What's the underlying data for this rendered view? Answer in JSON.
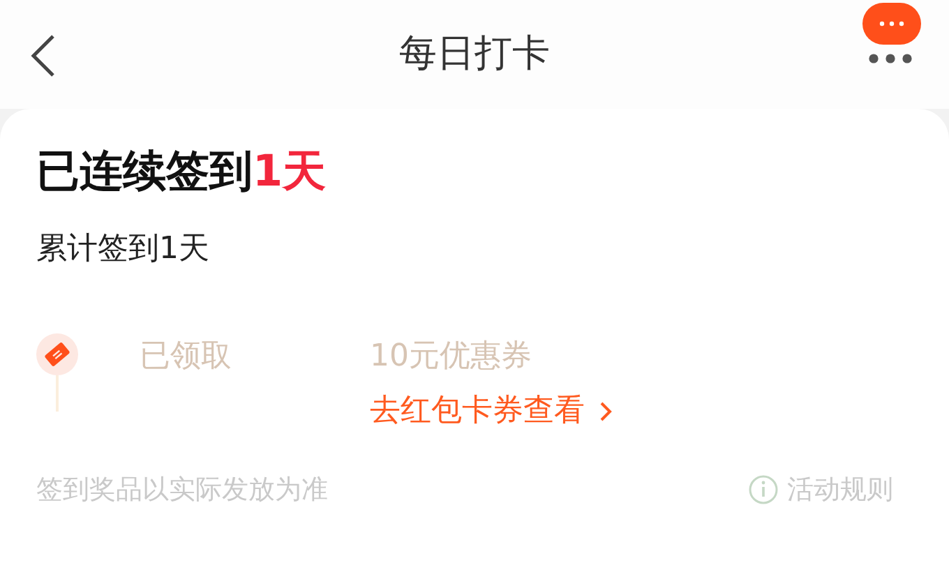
{
  "header": {
    "title": "每日打卡"
  },
  "summary": {
    "streak": "已连续签到**1天**",
    "total": "累计签到1天"
  },
  "rewards": [
    {
      "status": "已领取",
      "prize": "10元优惠券",
      "link": "去红包卡券查看"
    }
  ],
  "footer": {
    "note": "签到奖品以实际发放为准",
    "rules": "活动规则"
  }
}
